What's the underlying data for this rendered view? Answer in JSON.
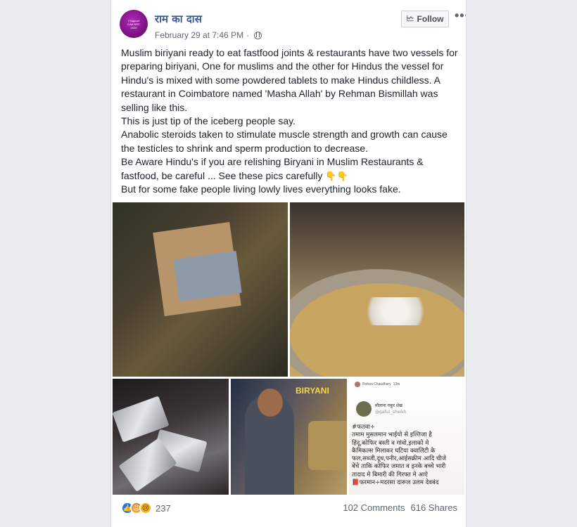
{
  "post": {
    "author": "राम का दास",
    "avatar_text": "I Support CAA NRC 2020",
    "date": "February 29 at 7:46 PM",
    "date_separator": "·",
    "follow_label": "Follow",
    "more_label": "•••",
    "text_lines": [
      "Muslim biriyani ready to eat fastfood joints & restaurants have two vessels for preparing biriyani, One for muslims and the other for Hindus the vessel for Hindu's is mixed with some powdered tablets to make Hindus childless. A restaurant in Coimbatore named 'Masha Allah' by Rehman Bismillah was selling like this.",
      "This is just tip of the iceberg people say.",
      "Anabolic steroids taken to stimulate muscle strength and growth can cause the testicles to shrink and sperm production to decrease.",
      "Be Aware Hindu's if you are relishing Biryani in Muslim Restaurants & fastfood, be careful ... See these pics carefully",
      "But for some fake people living lowly lives everything looks fake."
    ],
    "emoji_pointing": "👇👇"
  },
  "photos": {
    "biryani_label": "BIRYANI",
    "tweet": {
      "retweeter": "Rohan Chaudhary",
      "retweet_time": "13m",
      "name": "मौलाना गफूर शेख",
      "handle": "@gafur_sheikh",
      "lines": [
        "#फतवा÷",
        "तमाम मुसलमान भाईयो से इल्तिजा है",
        "हिंदू,कोफिर बस्ती व गांवो,इलाको मे",
        "कैमिकल्स मिलाकर घटिया क्वालिटी के",
        "फल,सब्जी,दूध,पनीर,आईसक्रीम आदि चीजे",
        "बेंचे ताकि कोफिर जमात व इनके बच्चे भारी",
        "तादाद मे बिमारी की गिरफ्त मे आऐ",
        "📕फरमान÷मदरसा दारूल उलम देवबंद"
      ]
    }
  },
  "footer": {
    "reaction_count": "237",
    "comments": "102 Comments",
    "shares": "616 Shares"
  },
  "colors": {
    "author_link": "#385898",
    "meta_gray": "#606770",
    "like_blue": "#1877f2",
    "page_bg": "#e9ebee"
  }
}
